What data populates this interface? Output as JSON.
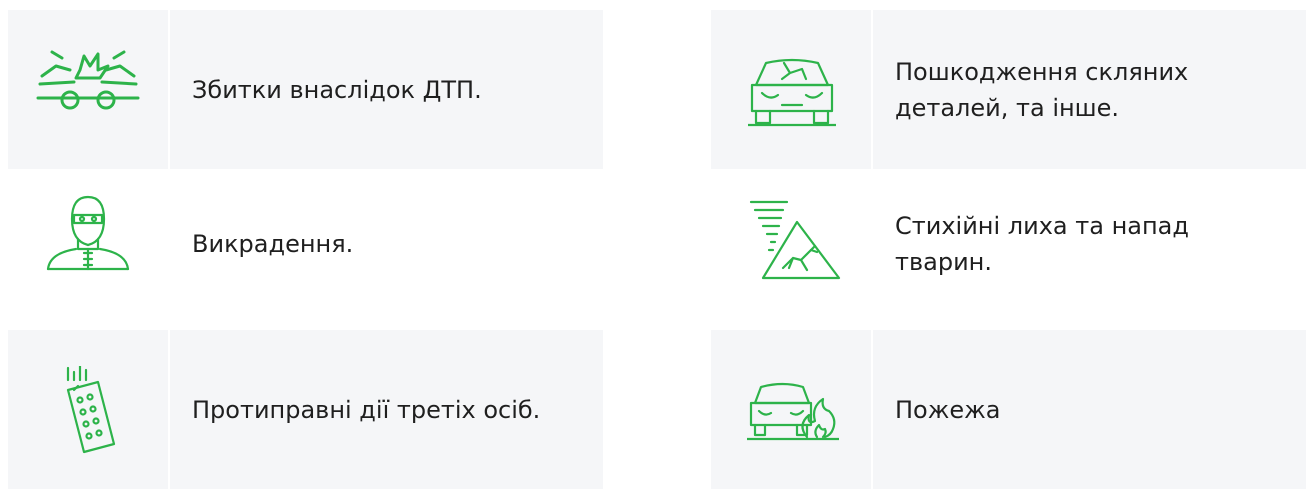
{
  "colors": {
    "card_bg": "#f5f6f8",
    "icon": "#2db34a",
    "text": "#1f1f1f"
  },
  "items": [
    {
      "label": "Збитки внаслідок ДТП.",
      "icon": "car-crash-icon"
    },
    {
      "label": "Пошкодження скляних деталей, та інше.",
      "icon": "broken-windshield-icon"
    },
    {
      "label": "Викрадення.",
      "icon": "masked-thief-icon"
    },
    {
      "label": "Стихійні лиха та напад тварин.",
      "icon": "tornado-animal-warning-icon"
    },
    {
      "label": "Протиправні дії третіх осіб.",
      "icon": "brick-vandalism-icon"
    },
    {
      "label": "Пожежа",
      "icon": "car-fire-icon"
    }
  ]
}
